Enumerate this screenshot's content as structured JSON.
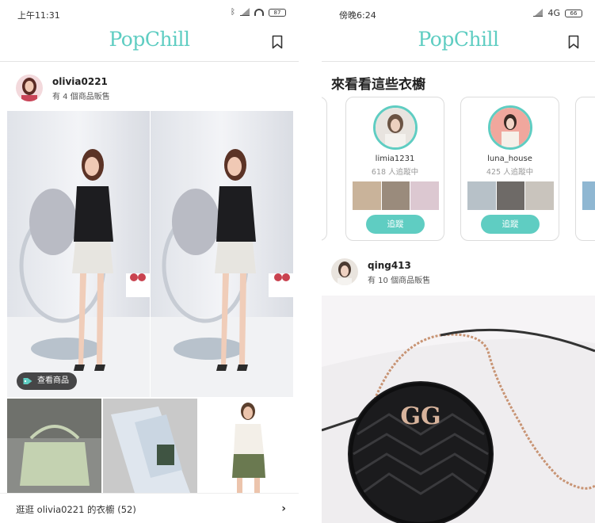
{
  "left": {
    "status": {
      "time": "上午11:31",
      "battery": "87"
    },
    "app": {
      "logo": "PopChill"
    },
    "post": {
      "username": "olivia0221",
      "subtitle": "有 4 個商品販售",
      "tag_button": "查看商品"
    },
    "wardrobe_link": "逛逛 olivia0221 的衣櫥 (52)"
  },
  "right": {
    "status": {
      "time": "傍晚6:24",
      "network": "4G",
      "battery": "66"
    },
    "app": {
      "logo": "PopChill"
    },
    "section_title": "來看看這些衣櫥",
    "cards": [
      {
        "username": "limia1231",
        "followers": "618 人追蹤中",
        "button": "追蹤"
      },
      {
        "username": "luna_house",
        "followers": "425 人追蹤中",
        "button": "追蹤"
      }
    ],
    "post": {
      "username": "qing413",
      "subtitle": "有 10 個商品販售"
    }
  },
  "colors": {
    "accent": "#5fcdc2"
  },
  "icons": [
    "bookmark-icon",
    "tag-icon",
    "chevron-right-icon",
    "bluetooth-icon",
    "wifi-icon",
    "signal-icon",
    "battery-icon"
  ]
}
